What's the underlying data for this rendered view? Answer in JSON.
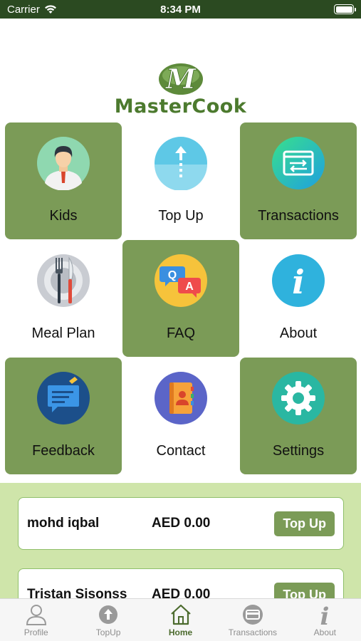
{
  "status_bar": {
    "carrier": "Carrier",
    "time": "8:34 PM"
  },
  "logo": {
    "mark_letter": "M",
    "text": "MasterCook"
  },
  "menu": [
    {
      "label": "Kids",
      "icon": "kid-avatar-icon",
      "style": "green"
    },
    {
      "label": "Top Up",
      "icon": "arrow-up-icon",
      "style": "white"
    },
    {
      "label": "Transactions",
      "icon": "transfer-window-icon",
      "style": "green"
    },
    {
      "label": "Meal Plan",
      "icon": "fork-knife-plate-icon",
      "style": "white"
    },
    {
      "label": "FAQ",
      "icon": "qa-bubbles-icon",
      "style": "green"
    },
    {
      "label": "About",
      "icon": "info-icon",
      "style": "white"
    },
    {
      "label": "Feedback",
      "icon": "feedback-note-icon",
      "style": "green"
    },
    {
      "label": "Contact",
      "icon": "contact-book-icon",
      "style": "white"
    },
    {
      "label": "Settings",
      "icon": "gear-icon",
      "style": "green"
    }
  ],
  "accounts": [
    {
      "name": "mohd iqbal",
      "balance": "AED 0.00",
      "button": "Top Up"
    },
    {
      "name": "Tristan Sisonss",
      "balance": "AED 0.00",
      "button": "Top Up"
    }
  ],
  "tabbar": [
    {
      "label": "Profile",
      "icon": "person-icon",
      "active": false
    },
    {
      "label": "TopUp",
      "icon": "arrow-up-circle-icon",
      "active": false
    },
    {
      "label": "Home",
      "icon": "house-icon",
      "active": true
    },
    {
      "label": "Transactions",
      "icon": "card-icon",
      "active": false
    },
    {
      "label": "About",
      "icon": "info-icon",
      "active": false
    }
  ],
  "colors": {
    "tile_green": "#7b9b57",
    "panel_green": "#cfe5aa",
    "status_bar": "#2b4a21",
    "brand": "#4c7a2e"
  }
}
